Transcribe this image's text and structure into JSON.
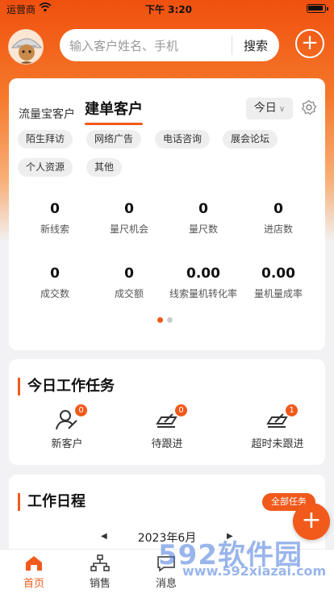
{
  "status": {
    "carrier": "运营商",
    "time": "下午 3:20"
  },
  "header": {
    "search_placeholder": "输入客户姓名、手机",
    "search_button": "搜索",
    "add_icon": "plus-icon"
  },
  "stats_card": {
    "tab_inactive": "流量宝客户",
    "tab_active": "建单客户",
    "period": "今日",
    "chips": [
      "陌生拜访",
      "网络广告",
      "电话咨询",
      "展会论坛",
      "个人资源",
      "其他"
    ],
    "stats": [
      {
        "value": "0",
        "label": "新线索"
      },
      {
        "value": "0",
        "label": "量尺机会"
      },
      {
        "value": "0",
        "label": "量尺数"
      },
      {
        "value": "0",
        "label": "进店数"
      },
      {
        "value": "0",
        "label": "成交数"
      },
      {
        "value": "0",
        "label": "成交额"
      },
      {
        "value": "0.00",
        "label": "线索量机转化率"
      },
      {
        "value": "0.00",
        "label": "量机量成率"
      }
    ],
    "page_total": 2,
    "page_current": 1
  },
  "tasks": {
    "title": "今日工作任务",
    "items": [
      {
        "label": "新客户",
        "count": "0",
        "icon": "new-customer-icon"
      },
      {
        "label": "待跟进",
        "count": "0",
        "icon": "follow-up-icon"
      },
      {
        "label": "超时未跟进",
        "count": "1",
        "icon": "overdue-icon"
      }
    ]
  },
  "schedule": {
    "title": "工作日程",
    "all_button": "全部任务",
    "month": "2023年6月"
  },
  "fab": {
    "label": "+"
  },
  "tabbar": {
    "items": [
      {
        "label": "首页",
        "active": true
      },
      {
        "label": "销售"
      },
      {
        "label": "消息"
      }
    ]
  },
  "watermark": {
    "line1": "592软件园",
    "line2": "www.592xiazai.com"
  },
  "colors": {
    "accent": "#f15a1b",
    "hero_top": "#f0500f"
  }
}
